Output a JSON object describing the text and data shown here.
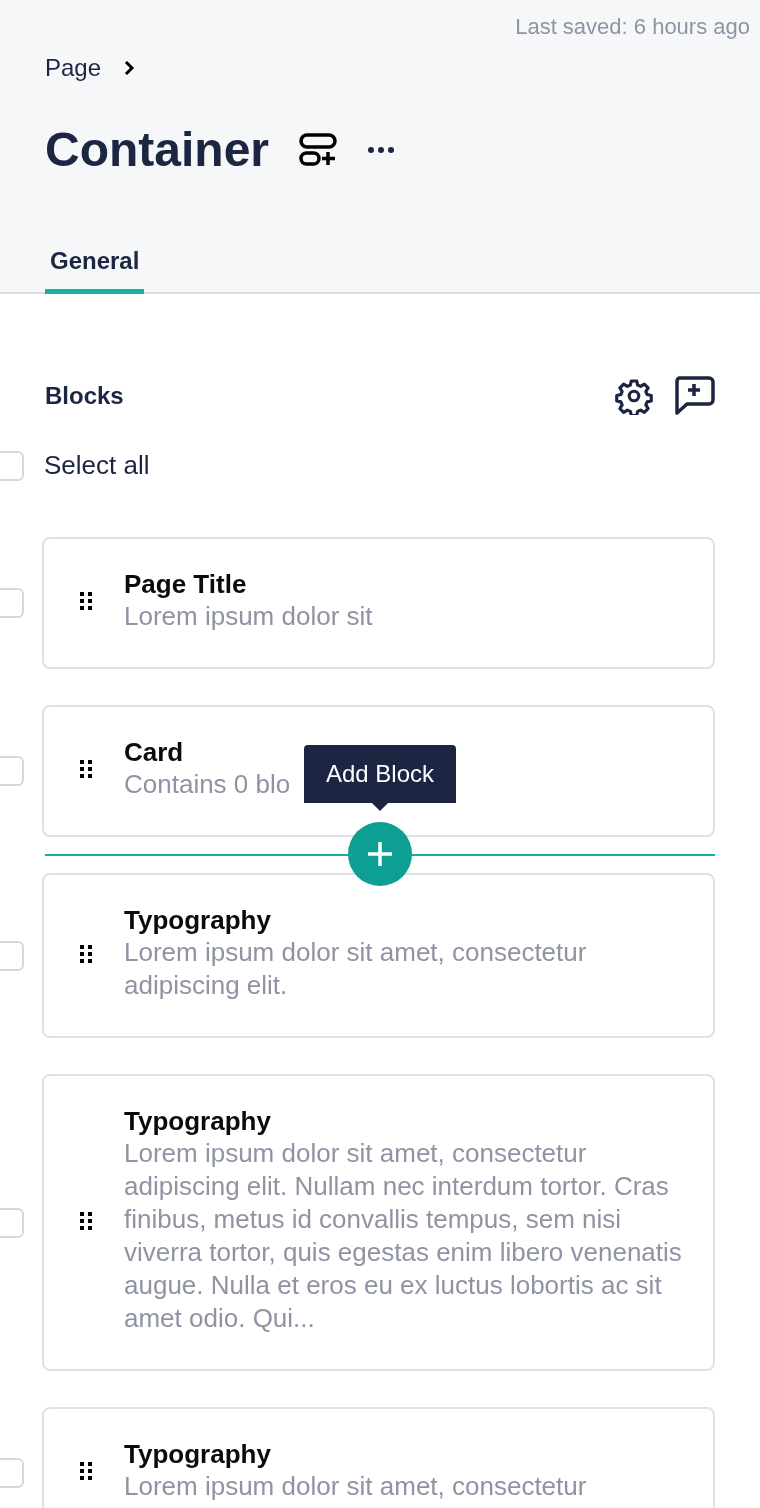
{
  "last_saved": "Last saved: 6 hours ago",
  "breadcrumb": [
    {
      "label": "Page"
    }
  ],
  "title": "Container",
  "tabs": [
    {
      "label": "General",
      "selected": true
    }
  ],
  "section": {
    "title": "Blocks"
  },
  "select_all": {
    "label": "Select all",
    "checked": false
  },
  "blocks": [
    {
      "title": "Page Title",
      "description": "Lorem ipsum dolor sit",
      "checked": false,
      "insert_below": false
    },
    {
      "title": "Card",
      "description": "Contains 0 blo",
      "checked": false,
      "insert_below": true
    },
    {
      "title": "Typography",
      "description": "Lorem ipsum dolor sit amet, consectetur adipiscing elit.",
      "checked": false,
      "insert_below": false
    },
    {
      "title": "Typography",
      "description": "Lorem ipsum dolor sit amet, consectetur adipiscing elit. Nullam nec interdum tortor. Cras finibus, metus id convallis tempus, sem nisi viverra tortor, quis egestas enim libero venenatis augue. Nulla et eros eu ex luctus lobortis ac sit amet odio. Qui...",
      "checked": false,
      "insert_below": false
    },
    {
      "title": "Typography",
      "description": "Lorem ipsum dolor sit amet, consectetur",
      "checked": false,
      "insert_below": false
    }
  ],
  "insert_tooltip": "Add Block"
}
